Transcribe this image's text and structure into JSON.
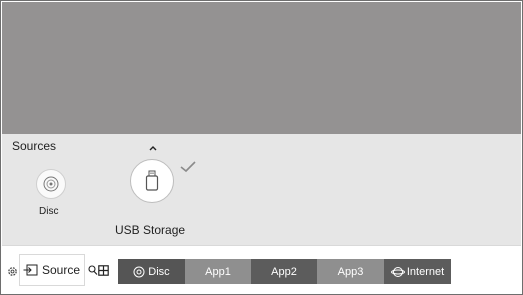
{
  "sources_panel": {
    "title": "Sources",
    "items": [
      {
        "label": "Disc",
        "icon": "disc-icon"
      },
      {
        "label": "USB Storage",
        "icon": "usb-storage-icon",
        "selected": true
      }
    ]
  },
  "bottom_bar": {
    "source_label": "Source",
    "channels": [
      {
        "label": "Disc",
        "icon": "disc-icon"
      },
      {
        "label": "App1"
      },
      {
        "label": "App2"
      },
      {
        "label": "App3"
      },
      {
        "label": "Internet",
        "icon": "internet-icon"
      }
    ]
  },
  "colors": {
    "tv_background": "#949292",
    "panel_background": "#e6e6e6",
    "tile_dark": "#5c5c5c",
    "tile_light": "#8f8f8f",
    "tile_selected": "#555555"
  }
}
